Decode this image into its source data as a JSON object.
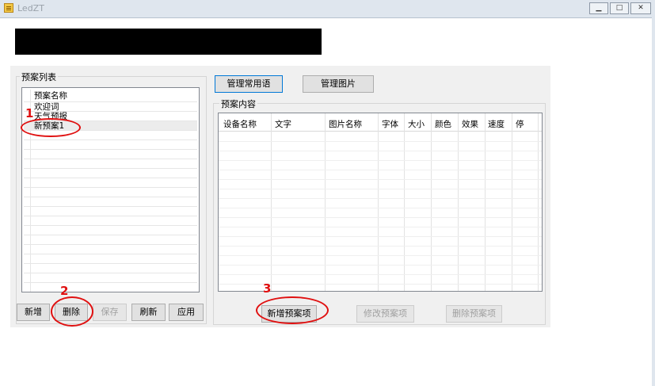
{
  "window": {
    "title": "LedZT",
    "minimize_glyph": "▁",
    "maximize_glyph": "□",
    "close_glyph": "✕"
  },
  "left_group": {
    "label": "预案列表",
    "list_header": "预案名称",
    "items": [
      "欢迎词",
      "天气预报",
      "新预案1"
    ]
  },
  "left_buttons": {
    "add": "新增",
    "delete": "删除",
    "save": "保存",
    "refresh": "刷新",
    "apply": "应用"
  },
  "top_buttons": {
    "manage_phrases": "管理常用语",
    "manage_images": "管理图片"
  },
  "right_group": {
    "label": "预案内容",
    "columns": [
      "设备名称",
      "文字",
      "图片名称",
      "字体",
      "大小",
      "颜色",
      "效果",
      "速度",
      "停"
    ]
  },
  "right_buttons": {
    "add_item": "新增预案项",
    "edit_item": "修改预案项",
    "delete_item": "删除预案项"
  },
  "annotations": [
    "1",
    "2",
    "3"
  ],
  "colors": {
    "annotation": "#e01010",
    "accent_border": "#0078d7"
  }
}
